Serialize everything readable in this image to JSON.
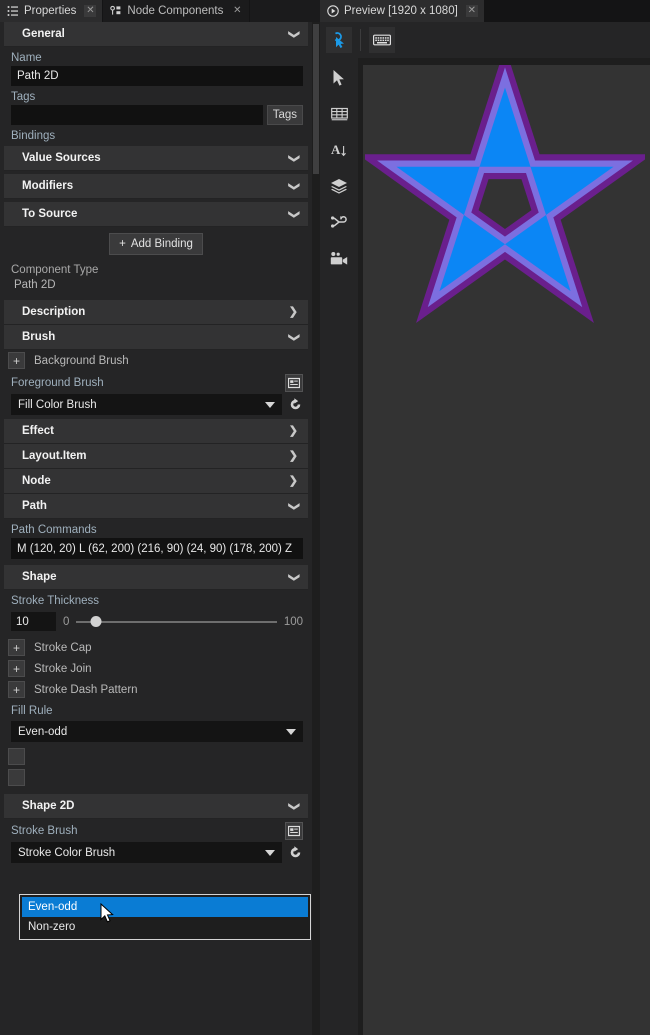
{
  "left_panel": {
    "tabs": [
      {
        "label": "Properties",
        "icon": "list-icon",
        "active": true,
        "close": "✕"
      },
      {
        "label": "Node Components",
        "icon": "node-components-icon",
        "active": false,
        "close": "✕"
      }
    ],
    "sections": {
      "general": {
        "label": "General",
        "state": "expanded",
        "chevron": "❯"
      },
      "description": {
        "label": "Description",
        "state": "collapsed",
        "chevron": "❯"
      },
      "brush": {
        "label": "Brush",
        "state": "expanded",
        "chevron": "❯"
      },
      "effect": {
        "label": "Effect",
        "state": "collapsed",
        "chevron": "❯"
      },
      "layout_item": {
        "label": "Layout.Item",
        "state": "collapsed",
        "chevron": "❯"
      },
      "node": {
        "label": "Node",
        "state": "collapsed",
        "chevron": "❯"
      },
      "path": {
        "label": "Path",
        "state": "expanded",
        "chevron": "❯"
      },
      "shape": {
        "label": "Shape",
        "state": "expanded",
        "chevron": "❯"
      },
      "shape2d": {
        "label": "Shape 2D",
        "state": "expanded",
        "chevron": "❯"
      },
      "value_sources": {
        "label": "Value Sources",
        "state": "expanded",
        "chevron": "❯"
      },
      "modifiers": {
        "label": "Modifiers",
        "state": "expanded",
        "chevron": "❯"
      },
      "to_source": {
        "label": "To Source",
        "state": "expanded",
        "chevron": "❯"
      }
    },
    "general": {
      "name_label": "Name",
      "name_value": "Path 2D",
      "tags_label": "Tags",
      "tags_value": "",
      "tags_button": "Tags",
      "bindings_label": "Bindings",
      "add_binding_label": "Add Binding",
      "add_binding_plus": "+",
      "component_type_label": "Component Type",
      "component_type_value": "Path 2D"
    },
    "brush": {
      "background_brush_label": "Background Brush",
      "background_brush_plus": "+",
      "foreground_brush_label": "Foreground Brush",
      "foreground_brush_value": "Fill Color Brush"
    },
    "path": {
      "path_commands_label": "Path Commands",
      "path_commands_value": "M (120, 20) L (62, 200) (216, 90) (24, 90) (178, 200) Z"
    },
    "shape": {
      "stroke_thickness_label": "Stroke Thickness",
      "stroke_thickness_value": "10",
      "stroke_thickness_min": "0",
      "stroke_thickness_max": "100",
      "stroke_thickness_percent": 10,
      "stroke_cap_label": "Stroke Cap",
      "stroke_cap_plus": "+",
      "stroke_join_label": "Stroke Join",
      "stroke_join_plus": "+",
      "stroke_dash_pattern_label": "Stroke Dash Pattern",
      "stroke_dash_pattern_plus": "+",
      "fill_rule_label": "Fill Rule",
      "fill_rule_value": "Even-odd",
      "fill_rule_options": [
        {
          "label": "Even-odd",
          "selected": true
        },
        {
          "label": "Non-zero",
          "selected": false
        }
      ]
    },
    "shape2d": {
      "stroke_brush_label": "Stroke Brush",
      "stroke_brush_value": "Stroke Color Brush"
    }
  },
  "right_panel": {
    "tab": {
      "label": "Preview [1920 x 1080]",
      "icon": "play-circle-icon",
      "close": "✕"
    },
    "toolbar": [
      {
        "name": "pointer-tap-tool",
        "active": true
      },
      {
        "name": "virtual-keyboard-tool",
        "active": false
      }
    ],
    "rail": [
      {
        "name": "select-cursor-tool"
      },
      {
        "name": "table-grid-tool"
      },
      {
        "name": "text-tool"
      },
      {
        "name": "layers-tool"
      },
      {
        "name": "node-graph-tool"
      },
      {
        "name": "camera-tool"
      }
    ],
    "canvas": {
      "background_color": "#333333",
      "shape": {
        "type": "pentagram",
        "fill_color": "#0b86f5",
        "inner_stroke_color": "#7c6fe0",
        "outer_stroke_color": "#6a1f8d",
        "path_commands": "M (120, 20) L (62, 200) (216, 90) (24, 90) (178, 200) Z",
        "fill_rule": "evenodd",
        "stroke_thickness": 10
      }
    }
  },
  "colors": {
    "accent_blue": "#0a7cd4",
    "panel_bg": "#252526",
    "section_bg": "#333334",
    "input_bg": "#141414",
    "label_blue": "#9fb0bd"
  }
}
